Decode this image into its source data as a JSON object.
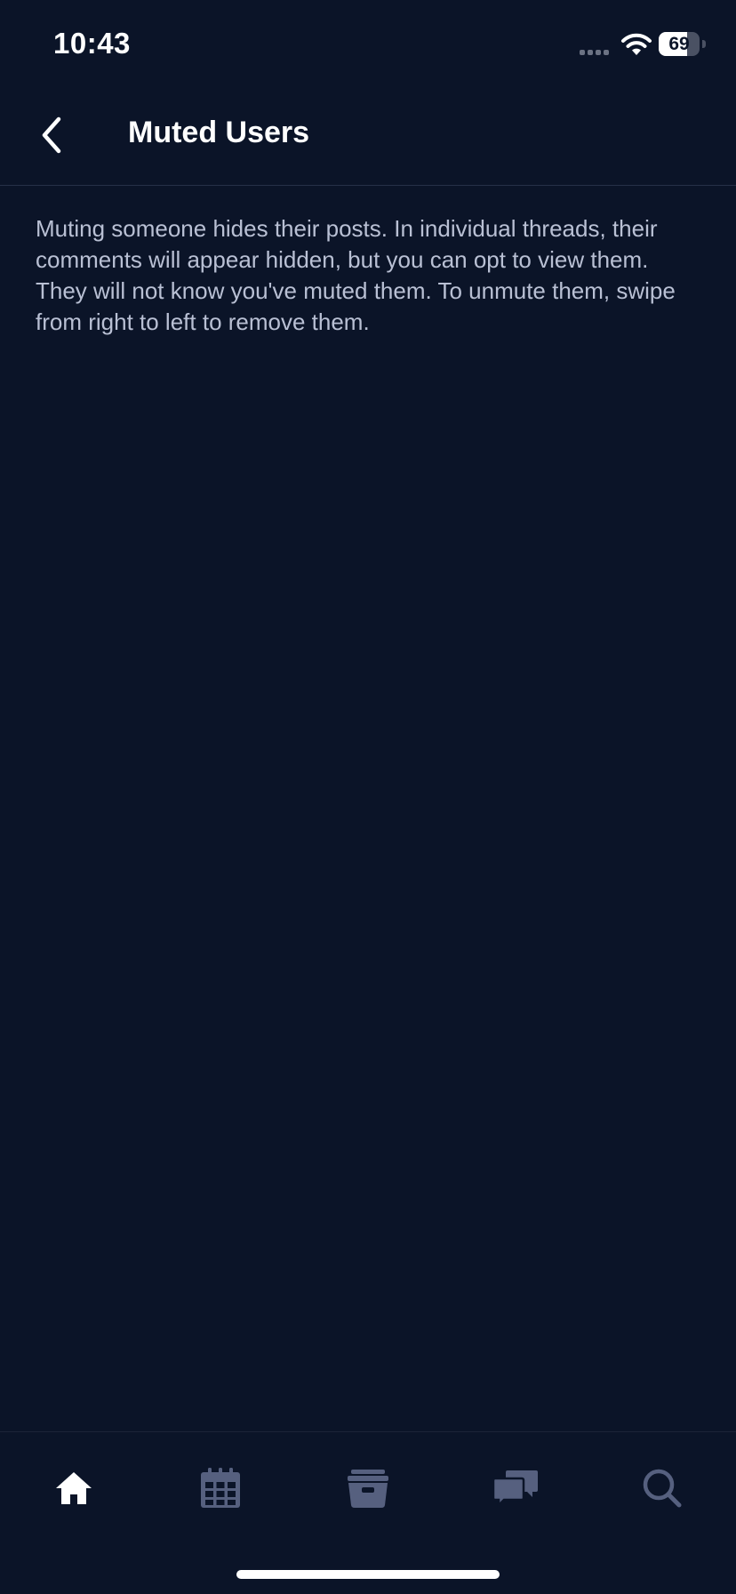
{
  "status_bar": {
    "time": "10:43",
    "battery_level": "69",
    "battery_fraction": 0.69
  },
  "header": {
    "title": "Muted Users",
    "back_icon": "chevron-left-icon"
  },
  "content": {
    "description": "Muting someone hides their posts. In individual threads, their comments will appear hidden, but you can opt to view them. They will not know you've muted them. To unmute them, swipe from right to left to remove them."
  },
  "tab_bar": {
    "tabs": [
      {
        "icon": "home-icon",
        "active": true
      },
      {
        "icon": "calendar-icon",
        "active": false
      },
      {
        "icon": "archive-box-icon",
        "active": false
      },
      {
        "icon": "chat-bubbles-icon",
        "active": false
      },
      {
        "icon": "search-icon",
        "active": false
      }
    ]
  },
  "colors": {
    "background": "#0b1428",
    "active_icon": "#ffffff",
    "inactive_icon": "#56607f",
    "body_text": "#b9c0d4"
  }
}
